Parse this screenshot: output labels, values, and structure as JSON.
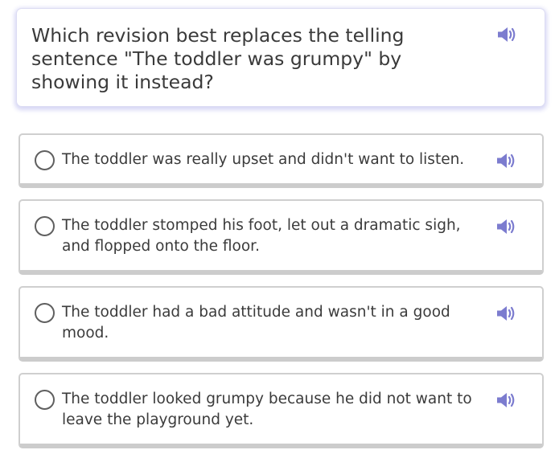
{
  "question": {
    "text": "Which revision best replaces the telling sentence \"The toddler was grumpy\" by showing it instead?",
    "speaker_icon": "speaker-icon"
  },
  "answers": [
    {
      "label": "The toddler was really upset and didn't want to listen.",
      "selected": false
    },
    {
      "label": "The toddler stomped his foot, let out a dramatic sigh, and flopped onto the floor.",
      "selected": false
    },
    {
      "label": "The toddler had a bad attitude and wasn't in a good mood.",
      "selected": false
    },
    {
      "label": "The toddler looked grumpy because he did not want to leave the playground yet.",
      "selected": false
    }
  ],
  "colors": {
    "speaker": "#7c7ccf",
    "question_glow": "#d7d7f5",
    "answer_border": "#cfcfcf",
    "text": "#3b3b3b"
  }
}
